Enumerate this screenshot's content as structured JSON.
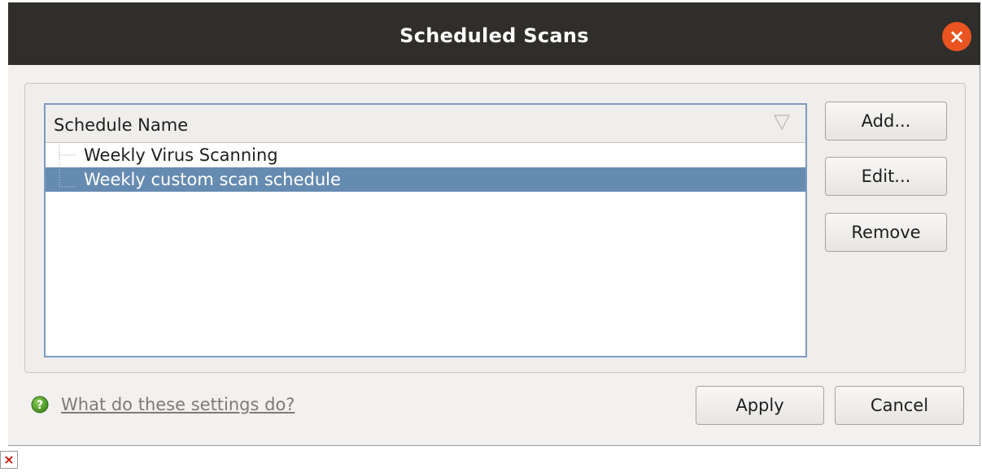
{
  "window": {
    "title": "Scheduled Scans",
    "close_icon": "close-icon",
    "close_glyph": "×"
  },
  "schedule_list": {
    "column_header": "Schedule Name",
    "sort_icon": "sort-descending-icon",
    "items": [
      {
        "label": "Weekly Virus Scanning",
        "selected": false
      },
      {
        "label": "Weekly custom scan schedule",
        "selected": true
      }
    ]
  },
  "side_buttons": {
    "add_label": "Add...",
    "edit_label": "Edit...",
    "remove_label": "Remove"
  },
  "footer": {
    "help_icon": "help-icon",
    "help_link": "What do these settings do?",
    "apply_label": "Apply",
    "cancel_label": "Cancel"
  },
  "colors": {
    "titlebar": "#302e2b",
    "close_button": "#e95420",
    "selection": "#668bb1",
    "dialog_background": "#f2f1f0"
  },
  "broken_image_icon": "broken-image-icon"
}
